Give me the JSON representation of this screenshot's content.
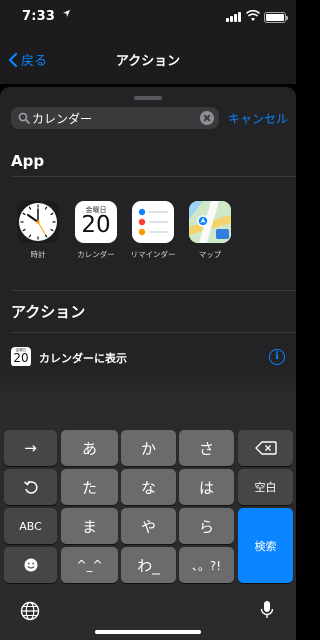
{
  "status_bar": {
    "time": "7:33"
  },
  "nav": {
    "back_label": "戻る",
    "title": "アクション"
  },
  "search": {
    "query": "カレンダー",
    "cancel_label": "キャンセル"
  },
  "apps_section": {
    "title": "App",
    "apps": [
      {
        "label": "時計",
        "icon": "clock-icon"
      },
      {
        "label": "カレンダー",
        "icon": "calendar-icon",
        "weekday": "金曜日",
        "day": "20"
      },
      {
        "label": "リマインダー",
        "icon": "reminders-icon"
      },
      {
        "label": "マップ",
        "icon": "maps-icon"
      }
    ]
  },
  "actions_section": {
    "title": "アクション",
    "items": [
      {
        "label": "カレンダーに表示",
        "icon_weekday": "金曜日",
        "icon_day": "20"
      }
    ]
  },
  "keyboard": {
    "row1": [
      "→",
      "あ",
      "か",
      "さ"
    ],
    "row2": [
      "た",
      "な",
      "は",
      "空白"
    ],
    "row3": [
      "ABC",
      "ま",
      "や",
      "ら",
      "検索"
    ],
    "row4": [
      "^_^",
      "わ_",
      "、。?!"
    ]
  },
  "colors": {
    "accent": "#0a84ff",
    "sheet": "#232325",
    "keyboard": "#2b2b2d"
  }
}
